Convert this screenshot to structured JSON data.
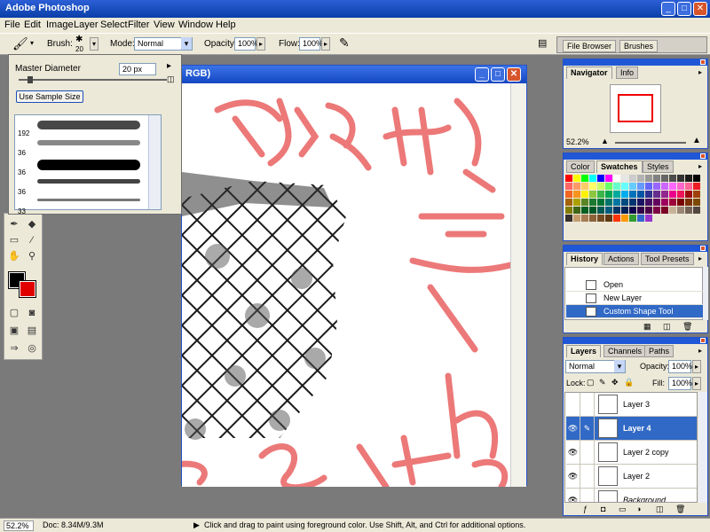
{
  "window": {
    "title": "Adobe Photoshop"
  },
  "menubar": [
    "File",
    "Edit",
    "Image",
    "Layer",
    "Select",
    "Filter",
    "View",
    "Window",
    "Help"
  ],
  "options": {
    "brush_label": "Brush:",
    "brush_size": "20",
    "mode_label": "Mode:",
    "mode_value": "Normal",
    "opacity_label": "Opacity:",
    "opacity_value": "100%",
    "flow_label": "Flow:",
    "flow_value": "100%"
  },
  "palette_well": {
    "tabs": [
      "File Browser",
      "Brushes"
    ]
  },
  "brush_popup": {
    "master_label": "Master Diameter",
    "master_value": "20 px",
    "use_sample": "Use Sample Size",
    "items": [
      {
        "size": "192"
      },
      {
        "size": "36"
      },
      {
        "size": "36"
      },
      {
        "size": "36"
      },
      {
        "size": "33"
      }
    ]
  },
  "document": {
    "title_visible": "RGB)"
  },
  "navigator": {
    "tabs": [
      "Navigator",
      "Info"
    ],
    "zoom": "52.2%"
  },
  "swatches": {
    "tabs": [
      "Color",
      "Swatches",
      "Styles"
    ],
    "colors": [
      "#ff0000",
      "#ffff00",
      "#00ff00",
      "#00ffff",
      "#0000ff",
      "#ff00ff",
      "#ffffff",
      "#e6e6e6",
      "#cccccc",
      "#b3b3b3",
      "#999999",
      "#808080",
      "#666666",
      "#4d4d4d",
      "#333333",
      "#1a1a1a",
      "#000000",
      "#ff6666",
      "#ff9966",
      "#ffcc66",
      "#ffff66",
      "#ccff66",
      "#66ff66",
      "#66ffcc",
      "#66ffff",
      "#66ccff",
      "#6699ff",
      "#6666ff",
      "#9966ff",
      "#cc66ff",
      "#ff66ff",
      "#ff66cc",
      "#ff6699",
      "#ee1d24",
      "#f26522",
      "#f7941d",
      "#fff200",
      "#8dc63f",
      "#39b54a",
      "#00a651",
      "#00a99d",
      "#00aeef",
      "#0072bc",
      "#0054a6",
      "#2e3192",
      "#662d91",
      "#92278f",
      "#ec008c",
      "#ed145b",
      "#9e0b0f",
      "#a0410d",
      "#a36209",
      "#aba000",
      "#598527",
      "#1a7b30",
      "#007236",
      "#00746b",
      "#0076a3",
      "#004b80",
      "#003471",
      "#1b1464",
      "#440e62",
      "#630460",
      "#9e005d",
      "#9e0039",
      "#790000",
      "#7b2e00",
      "#7d4900",
      "#827b00",
      "#406618",
      "#005e20",
      "#005826",
      "#005952",
      "#005b7f",
      "#003663",
      "#002157",
      "#0d004c",
      "#32004b",
      "#4b0049",
      "#7b0046",
      "#7a0026",
      "#c7b299",
      "#998675",
      "#736357",
      "#534741",
      "#37302d",
      "#c69c6d",
      "#a67c52",
      "#8c6239",
      "#754c24",
      "#603813",
      "#ff3300",
      "#ff9900",
      "#339933",
      "#3366cc",
      "#9933cc"
    ]
  },
  "history": {
    "tabs": [
      "History",
      "Actions",
      "Tool Presets"
    ],
    "items": [
      {
        "label": "Open"
      },
      {
        "label": "New Layer"
      },
      {
        "label": "Custom Shape Tool"
      }
    ]
  },
  "layers": {
    "tabs": [
      "Layers",
      "Channels",
      "Paths"
    ],
    "mode": "Normal",
    "opacity_label": "Opacity:",
    "opacity_value": "100%",
    "lock_label": "Lock:",
    "fill_label": "Fill:",
    "fill_value": "100%",
    "items": [
      {
        "name": "Layer 3"
      },
      {
        "name": "Layer 4"
      },
      {
        "name": "Layer 2 copy"
      },
      {
        "name": "Layer 2"
      },
      {
        "name": "Background"
      }
    ]
  },
  "status": {
    "zoom": "52.2%",
    "doc": "Doc: 8.34M/9.3M",
    "hint": "Click and drag to paint using foreground color.  Use Shift, Alt, and Ctrl for additional options."
  },
  "colors": {
    "foreground": "#000000",
    "background": "#e00000",
    "selection": "#3169c6"
  },
  "scribble_text": [
    "Z",
    "e"
  ]
}
